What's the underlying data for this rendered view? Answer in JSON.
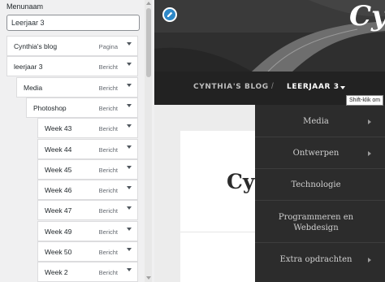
{
  "menu_settings": {
    "name_label": "Menunaam",
    "name_value": "Leerjaar 3"
  },
  "menu_items": [
    {
      "label": "Cynthia's blog",
      "type": "Pagina",
      "depth": 0
    },
    {
      "label": "leerjaar 3",
      "type": "Bericht",
      "depth": 0
    },
    {
      "label": "Media",
      "type": "Bericht",
      "depth": 1
    },
    {
      "label": "Photoshop",
      "type": "Bericht",
      "depth": 2
    },
    {
      "label": "Week 43",
      "type": "Bericht",
      "depth": 3
    },
    {
      "label": "Week 44",
      "type": "Bericht",
      "depth": 3
    },
    {
      "label": "Week 45",
      "type": "Bericht",
      "depth": 3
    },
    {
      "label": "Week 46",
      "type": "Bericht",
      "depth": 3
    },
    {
      "label": "Week 47",
      "type": "Bericht",
      "depth": 3
    },
    {
      "label": "Week 49",
      "type": "Bericht",
      "depth": 3
    },
    {
      "label": "Week 50",
      "type": "Bericht",
      "depth": 3
    },
    {
      "label": "Week 2",
      "type": "Bericht",
      "depth": 3
    }
  ],
  "site": {
    "logo_text": "Cyn",
    "nav_blog": "CYNTHIA'S BLOG",
    "nav_separator": "/",
    "nav_active": "LEERJAAR 3",
    "tooltip": "Shift-klik om",
    "content_title": "Cyn"
  },
  "dropdown_items": [
    {
      "label": "Media",
      "has_submenu": true
    },
    {
      "label": "Ontwerpen",
      "has_submenu": true
    },
    {
      "label": "Technologie",
      "has_submenu": false
    },
    {
      "label": "Programmeren en Webdesign",
      "has_submenu": false
    },
    {
      "label": "Extra opdrachten",
      "has_submenu": true
    }
  ],
  "colors": {
    "accent": "#2e88c7",
    "nav_bg": "#222222",
    "dropdown_bg": "#2c2c2c"
  }
}
